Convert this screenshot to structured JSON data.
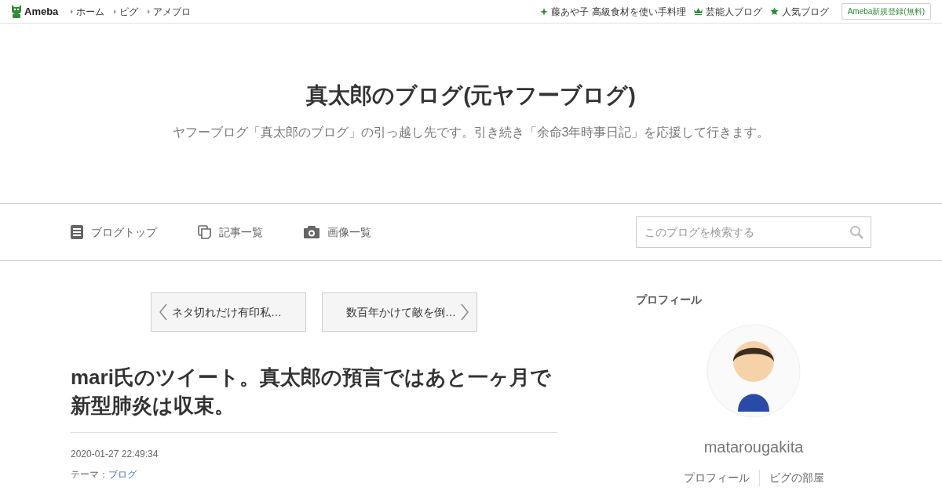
{
  "header": {
    "logo": "Ameba",
    "links": [
      "ホーム",
      "ピグ",
      "アメブロ"
    ],
    "right_links": [
      {
        "kind": "sparkle",
        "label": "藤あや子 高級食材を使い手料理"
      },
      {
        "kind": "crown",
        "label": "芸能人ブログ"
      },
      {
        "kind": "star",
        "label": "人気ブログ"
      }
    ],
    "signup": "Ameba新規登録(無料)"
  },
  "blog": {
    "title": "真太郎のブログ(元ヤフーブログ)",
    "description": "ヤフーブログ「真太郎のブログ」の引っ越し先です。引き続き「余命3年時事日記」を応援して行きます。"
  },
  "nav": {
    "items": [
      {
        "kind": "top",
        "label": "ブログトップ"
      },
      {
        "kind": "list",
        "label": "記事一覧"
      },
      {
        "kind": "camera",
        "label": "画像一覧"
      }
    ],
    "search": {
      "placeholder": "このブログを検索する"
    }
  },
  "pager": {
    "prev": "ネタ切れだけ有印私…",
    "next": "数百年かけて敵を倒…"
  },
  "article": {
    "title": "mari氏のツイート。真太郎の預言ではあと一ヶ月で新型肺炎は収束。",
    "date": "2020-01-27 22:49:34",
    "theme_label": "テーマ：",
    "theme": "ブログ"
  },
  "profile": {
    "heading": "プロフィール",
    "name": "matarougakita",
    "links": [
      "プロフィール",
      "ピグの部屋"
    ]
  }
}
